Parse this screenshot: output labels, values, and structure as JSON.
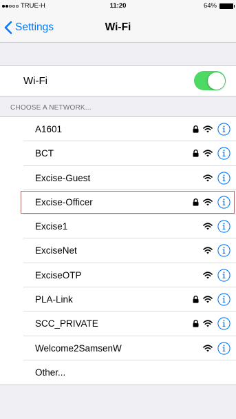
{
  "status_bar": {
    "carrier": "TRUE-H",
    "time": "11:20",
    "battery": "64%"
  },
  "nav": {
    "back_label": "Settings",
    "title": "Wi-Fi"
  },
  "wifi_toggle": {
    "label": "Wi-Fi",
    "on": true
  },
  "section_header": "CHOOSE A NETWORK...",
  "networks": [
    {
      "name": "A1601",
      "secured": true
    },
    {
      "name": "BCT",
      "secured": true
    },
    {
      "name": "Excise-Guest",
      "secured": false
    },
    {
      "name": "Excise-Officer",
      "secured": true,
      "highlighted": true
    },
    {
      "name": "Excise1",
      "secured": false
    },
    {
      "name": "ExciseNet",
      "secured": false
    },
    {
      "name": "ExciseOTP",
      "secured": false
    },
    {
      "name": "PLA-Link",
      "secured": true
    },
    {
      "name": "SCC_PRIVATE",
      "secured": true
    },
    {
      "name": "Welcome2SamsenW",
      "secured": false
    }
  ],
  "other_label": "Other...",
  "colors": {
    "accent": "#007aff",
    "toggle_on": "#4cd964",
    "highlight_border": "#b06a6a"
  },
  "icons": {
    "lock": "lock-icon",
    "wifi": "wifi-signal-icon",
    "info": "info-icon",
    "back": "chevron-left-icon"
  }
}
